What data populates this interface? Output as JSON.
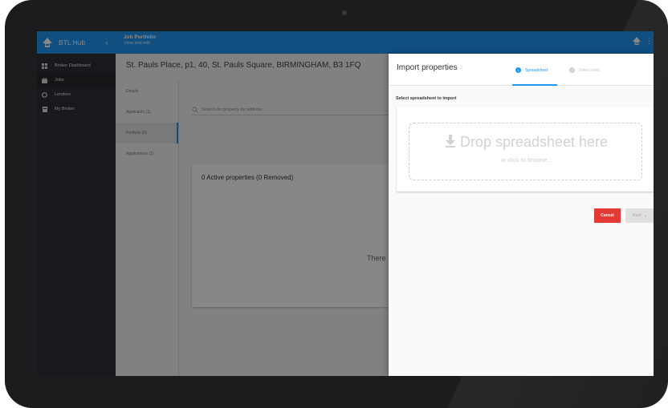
{
  "app": {
    "name": "BTL Hub",
    "collapse_glyph": "‹"
  },
  "sidebar": {
    "items": [
      {
        "label": "Broker Dashboard",
        "icon": "dashboard-icon"
      },
      {
        "label": "Jobs",
        "icon": "briefcase-icon"
      },
      {
        "label": "Lenders",
        "icon": "lender-icon"
      },
      {
        "label": "My Broker",
        "icon": "contact-card-icon"
      }
    ]
  },
  "appbar": {
    "title": "Job Portfolio",
    "subtitle": "View and edit",
    "more_glyph": "⋮"
  },
  "main": {
    "address": "St. Pauls Place, p1, 40, St. Pauls Square, BIRMINGHAM, B3 1FQ",
    "nav": [
      "Details",
      "Applicants (1)",
      "Portfolio (0)",
      "Applications (1)"
    ],
    "search_placeholder": "Search for property by address",
    "properties_title": "0 Active properties (0 Removed)",
    "empty_text": "There"
  },
  "import_panel": {
    "title": "Import properties",
    "steps": [
      {
        "num": "1",
        "label": "Spreadsheet"
      },
      {
        "num": "2",
        "label": "Select rows"
      }
    ],
    "section_label": "Select spreadsheet to import",
    "drop_text": "Drop spreadsheet here",
    "drop_subtext": "or click to browse...",
    "cancel_label": "Cancel",
    "next_label": "Next",
    "next_glyph": "›"
  },
  "colors": {
    "primary": "#2196f3",
    "danger": "#e53935",
    "sidebar": "#2d3035"
  }
}
